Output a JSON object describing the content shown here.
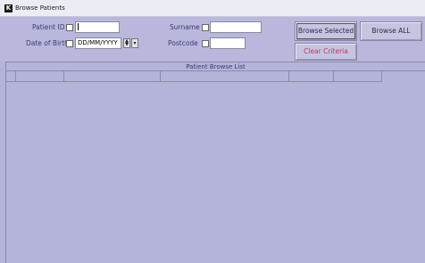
{
  "window": {
    "title": "Browse Patients",
    "icon": "app-k-icon"
  },
  "criteria": {
    "patient_id_label": "Patient ID",
    "patient_id_value": "",
    "dob_label": "Date of Birth",
    "dob_value": "DD/MM/YYYY",
    "surname_label": "Surname",
    "surname_value": "",
    "postcode_label": "Postcode",
    "postcode_value": ""
  },
  "buttons": {
    "browse_selected": "Browse Selected",
    "browse_all": "Browse ALL",
    "clear_criteria": "Clear Criteria"
  },
  "grid": {
    "title": "Patient Browse List",
    "columns": [
      "",
      "",
      "",
      "",
      "",
      ""
    ]
  },
  "colors": {
    "background": "#b4b3da",
    "clear_text": "#d03060"
  }
}
